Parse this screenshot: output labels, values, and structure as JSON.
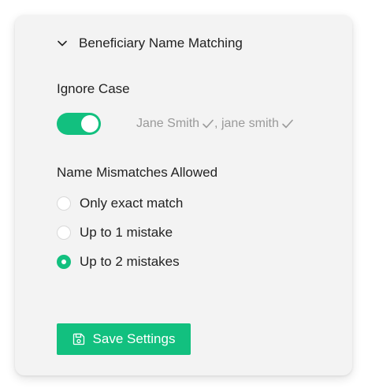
{
  "section": {
    "title": "Beneficiary Name Matching",
    "chevron_icon": "chevron-down-icon"
  },
  "ignore_case": {
    "label": "Ignore Case",
    "enabled": true,
    "example_1": "Jane Smith",
    "example_2": ", jane smith",
    "check_icon": "check-icon"
  },
  "mismatches": {
    "label": "Name Mismatches Allowed",
    "options": [
      {
        "label": "Only exact match",
        "selected": false
      },
      {
        "label": "Up to 1 mistake",
        "selected": false
      },
      {
        "label": "Up to 2 mistakes",
        "selected": true
      }
    ]
  },
  "save_button": {
    "label": "Save Settings",
    "icon": "save-icon"
  },
  "colors": {
    "accent": "#12c07f",
    "card_bg": "#f3f3f3",
    "muted_text": "#9a9a9a"
  }
}
